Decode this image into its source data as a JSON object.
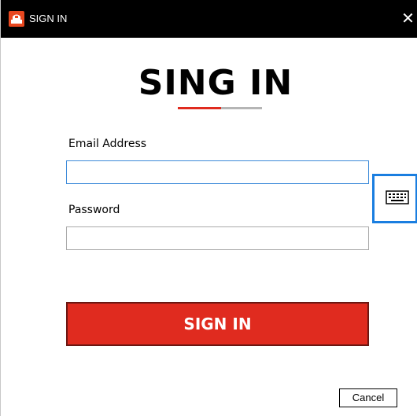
{
  "window": {
    "title": "SIGN IN",
    "close_glyph": "✕"
  },
  "form": {
    "heading": "SING IN",
    "email_label": "Email Address",
    "email_value": "",
    "password_label": "Password",
    "password_value": "",
    "submit_label": "SIGN IN",
    "cancel_label": "Cancel",
    "keyboard_icon": "keyboard-icon"
  },
  "colors": {
    "titlebar": "#000000",
    "accent_red": "#e02b1f",
    "focus_blue": "#1a7ee0"
  }
}
